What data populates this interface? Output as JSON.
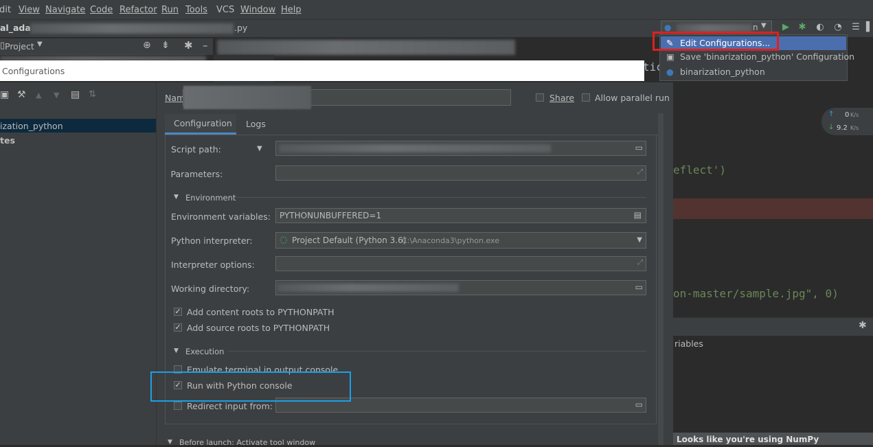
{
  "menu": [
    "dit",
    "View",
    "Navigate",
    "Code",
    "Refactor",
    "Run",
    "Tools",
    "VCS",
    "Window",
    "Help"
  ],
  "navbar": {
    "project_crumb": "al_ada",
    "file_suffix": ".py"
  },
  "project_tool": {
    "label": "Project"
  },
  "editor": {
    "code_fragments": [
      "tic",
      "eflect')",
      "on-master/sample.jpg\", 0)"
    ],
    "panel_text": "riables",
    "numpy_hint": "Looks like you're using NumPy"
  },
  "run_dropdown": {
    "items": [
      {
        "label": "Edit Configurations...",
        "icon": "pencil-icon",
        "selected": true
      },
      {
        "label": "Save 'binarization_python' Configuration",
        "icon": "save-icon",
        "selected": false
      },
      {
        "label": "binarization_python",
        "icon": "python-icon",
        "selected": false
      }
    ]
  },
  "dialog": {
    "title": "Configurations",
    "tree": {
      "item": "ization_python",
      "templates": "tes"
    },
    "name_label": "Nam",
    "share_label": "Share",
    "allow_parallel_label": "Allow parallel run",
    "tabs": [
      {
        "label": "Configuration",
        "active": true
      },
      {
        "label": "Logs",
        "active": false
      }
    ],
    "script_path_label": "Script path:",
    "parameters_label": "Parameters:",
    "environment_section": "Environment",
    "env_vars_label": "Environment variables:",
    "env_vars_value": "PYTHONUNBUFFERED=1",
    "interpreter_label": "Python interpreter:",
    "interpreter_value": "Project Default (Python 3.6)",
    "interpreter_path": "C:\\Anaconda3\\python.exe",
    "interp_options_label": "Interpreter options:",
    "working_dir_label": "Working directory:",
    "add_content_roots": "Add content roots to PYTHONPATH",
    "add_source_roots": "Add source roots to PYTHONPATH",
    "execution_section": "Execution",
    "emulate_terminal": "Emulate terminal in output console",
    "run_with_console": "Run with Python console",
    "redirect_input": "Redirect input from:",
    "before_launch": "Before launch: Activate tool window"
  },
  "network": {
    "up": "0",
    "up_unit": "K/s",
    "down": "9.2",
    "down_unit": "K/s"
  },
  "colors": {
    "selected": "#4b6eaf",
    "highlight_red": "#e02020",
    "highlight_blue": "#1aa0e8",
    "run_green": "#59a869"
  }
}
